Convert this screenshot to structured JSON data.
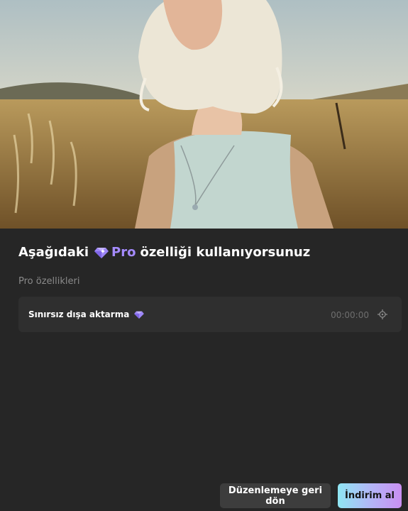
{
  "preview": {
    "image": "woman-in-golden-field"
  },
  "dialog": {
    "heading_prefix": "Aşağıdaki",
    "heading_pro": "Pro",
    "heading_suffix": "özelliği kullanıyorsunuz",
    "section_label": "Pro özellikleri",
    "features": [
      {
        "name": "Sınırsız dışa aktarma",
        "time": "00:00:00",
        "icon": "locate-icon"
      }
    ]
  },
  "buttons": {
    "back_label": "Düzenlemeye geri dön",
    "download_label": "İndirim al"
  },
  "colors": {
    "background": "#262626",
    "pro_accent": "#a58bff",
    "row_bg": "#2f2f2f",
    "gradient_start": "#8fe6f3",
    "gradient_end": "#c98ff2"
  }
}
